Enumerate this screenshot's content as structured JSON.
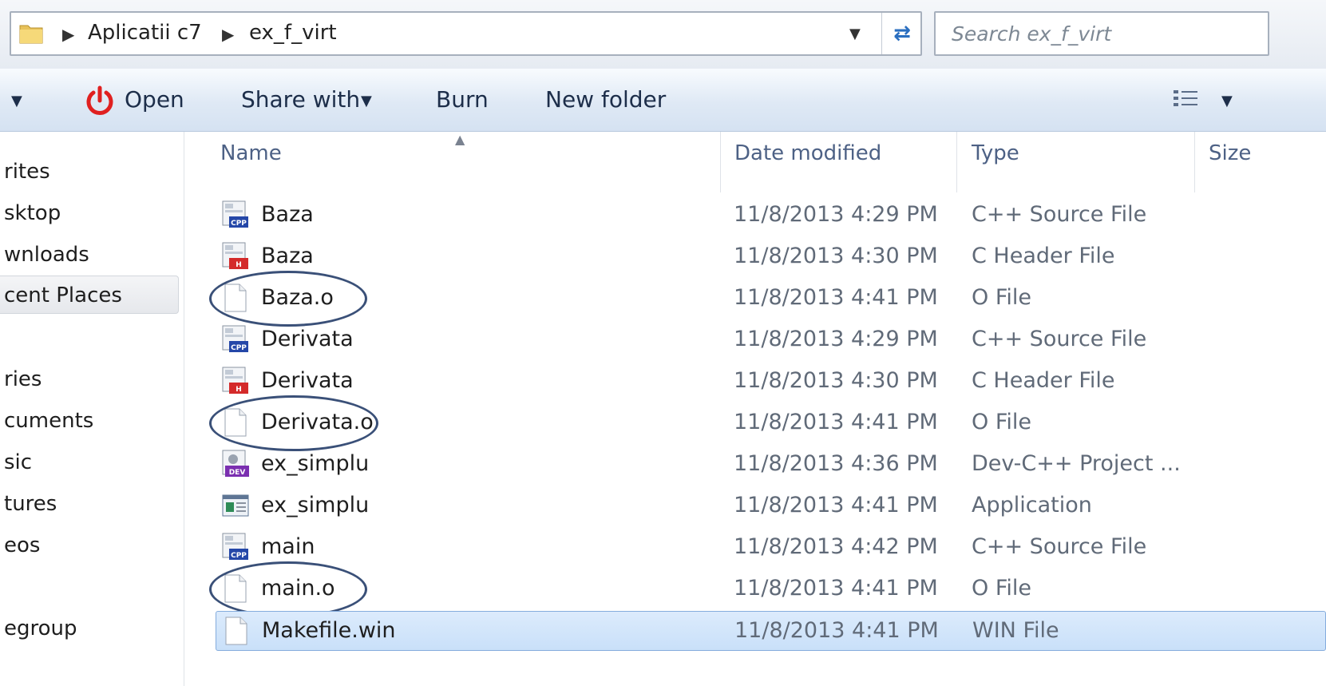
{
  "address": {
    "crumbs": [
      "Aplicatii c7",
      "ex_f_virt"
    ],
    "search_placeholder": "Search ex_f_virt"
  },
  "toolbar": {
    "open_label": "Open",
    "share_label": "Share with",
    "burn_label": "Burn",
    "new_folder_label": "New folder"
  },
  "nav": {
    "items": [
      {
        "label": "rites"
      },
      {
        "label": "sktop"
      },
      {
        "label": "wnloads"
      },
      {
        "label": "cent Places"
      },
      {
        "label": "ries"
      },
      {
        "label": "cuments"
      },
      {
        "label": "sic"
      },
      {
        "label": "tures"
      },
      {
        "label": "eos"
      },
      {
        "label": "egroup"
      }
    ]
  },
  "columns": {
    "name": "Name",
    "date": "Date modified",
    "type": "Type",
    "size": "Size"
  },
  "files": [
    {
      "name": "Baza",
      "date": "11/8/2013 4:29 PM",
      "type": "C++ Source File",
      "icon": "cpp-file-icon"
    },
    {
      "name": "Baza",
      "date": "11/8/2013 4:30 PM",
      "type": "C Header File",
      "icon": "header-file-icon"
    },
    {
      "name": "Baza.o",
      "date": "11/8/2013 4:41 PM",
      "type": "O File",
      "icon": "blank-file-icon",
      "circled": true
    },
    {
      "name": "Derivata",
      "date": "11/8/2013 4:29 PM",
      "type": "C++ Source File",
      "icon": "cpp-file-icon"
    },
    {
      "name": "Derivata",
      "date": "11/8/2013 4:30 PM",
      "type": "C Header File",
      "icon": "header-file-icon"
    },
    {
      "name": "Derivata.o",
      "date": "11/8/2013 4:41 PM",
      "type": "O File",
      "icon": "blank-file-icon",
      "circled": true
    },
    {
      "name": "ex_simplu",
      "date": "11/8/2013 4:36 PM",
      "type": "Dev-C++ Project ...",
      "icon": "devcpp-project-icon"
    },
    {
      "name": "ex_simplu",
      "date": "11/8/2013 4:41 PM",
      "type": "Application",
      "icon": "application-icon"
    },
    {
      "name": "main",
      "date": "11/8/2013 4:42 PM",
      "type": "C++ Source File",
      "icon": "cpp-file-icon"
    },
    {
      "name": "main.o",
      "date": "11/8/2013 4:41 PM",
      "type": "O File",
      "icon": "blank-file-icon",
      "circled": true
    },
    {
      "name": "Makefile.win",
      "date": "11/8/2013 4:41 PM",
      "type": "WIN File",
      "icon": "blank-file-icon",
      "selected": true
    }
  ],
  "colors": {
    "annotation_circle": "#3a5078",
    "selection": "#cfe3fa",
    "open_power": "#e02020",
    "header_text": "#4d6185"
  }
}
